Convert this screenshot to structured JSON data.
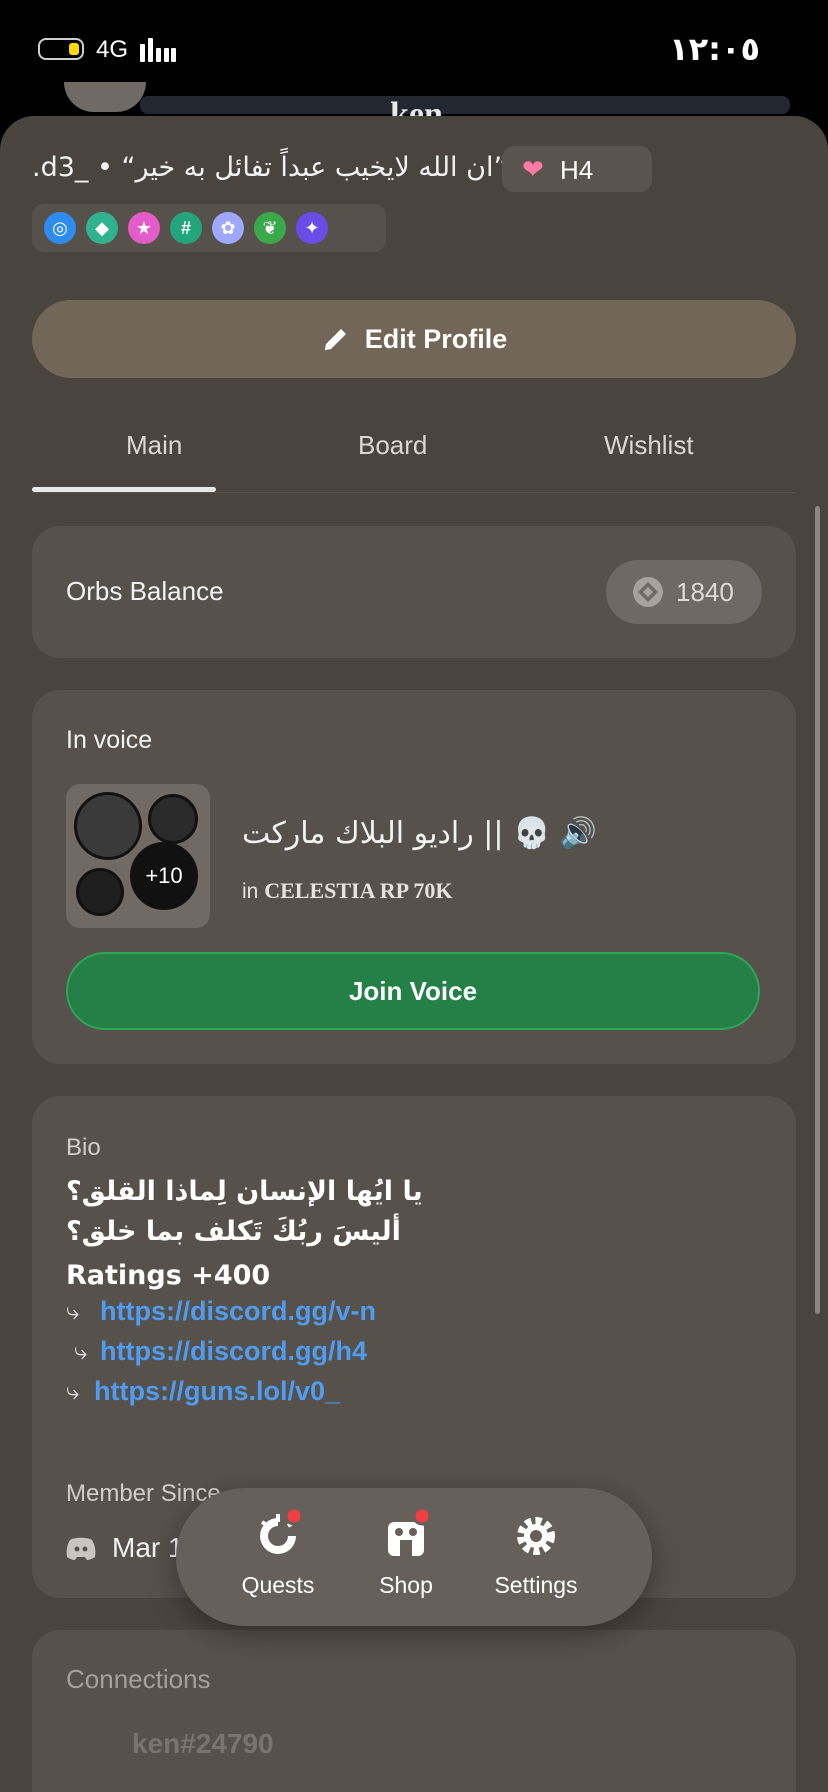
{
  "status_bar": {
    "network": "4G",
    "time": "١٢:٠٥"
  },
  "profile": {
    "name_peek": "ken",
    "status_text": ".d3_ • “ان الله لايخيب عبداً تفائل به خير”",
    "tag": "H4",
    "badges": [
      "nitro-badge",
      "boost-badge",
      "quest-badge",
      "hashtag-badge",
      "hypesquad-badge",
      "leaf-badge",
      "orb-badge"
    ]
  },
  "edit_profile": {
    "label": "Edit Profile"
  },
  "tabs": [
    {
      "label": "Main",
      "active": true
    },
    {
      "label": "Board"
    },
    {
      "label": "Wishlist"
    }
  ],
  "orbs": {
    "label": "Orbs Balance",
    "value": "1840"
  },
  "voice": {
    "title": "In voice",
    "more_count": "+10",
    "channel": "راديو البلاك ماركت || 💀 🔊",
    "server_prefix": "in",
    "server": "CELESTIA RP 70K",
    "join_label": "Join Voice"
  },
  "bio": {
    "heading": "Bio",
    "lines": [
      "يا ايُها الإنسان لِماذا القلق؟",
      "أليسَ ربُكَ تَكلف بما خلق؟",
      "Ratings +400"
    ],
    "links": [
      "https://discord.gg/v-n",
      "https://discord.gg/h4",
      "https://guns.lol/v0_"
    ],
    "arrow": "⤷",
    "member_since_label": "Member Since",
    "member_since_date": "Mar 10, 2017"
  },
  "connections": {
    "heading": "Connections",
    "user": "ken#24790"
  },
  "nav": {
    "quests": "Quests",
    "shop": "Shop",
    "settings": "Settings"
  },
  "colors": {
    "join": "#248046",
    "link": "#4f9cf0",
    "notify": "#f23f43"
  }
}
